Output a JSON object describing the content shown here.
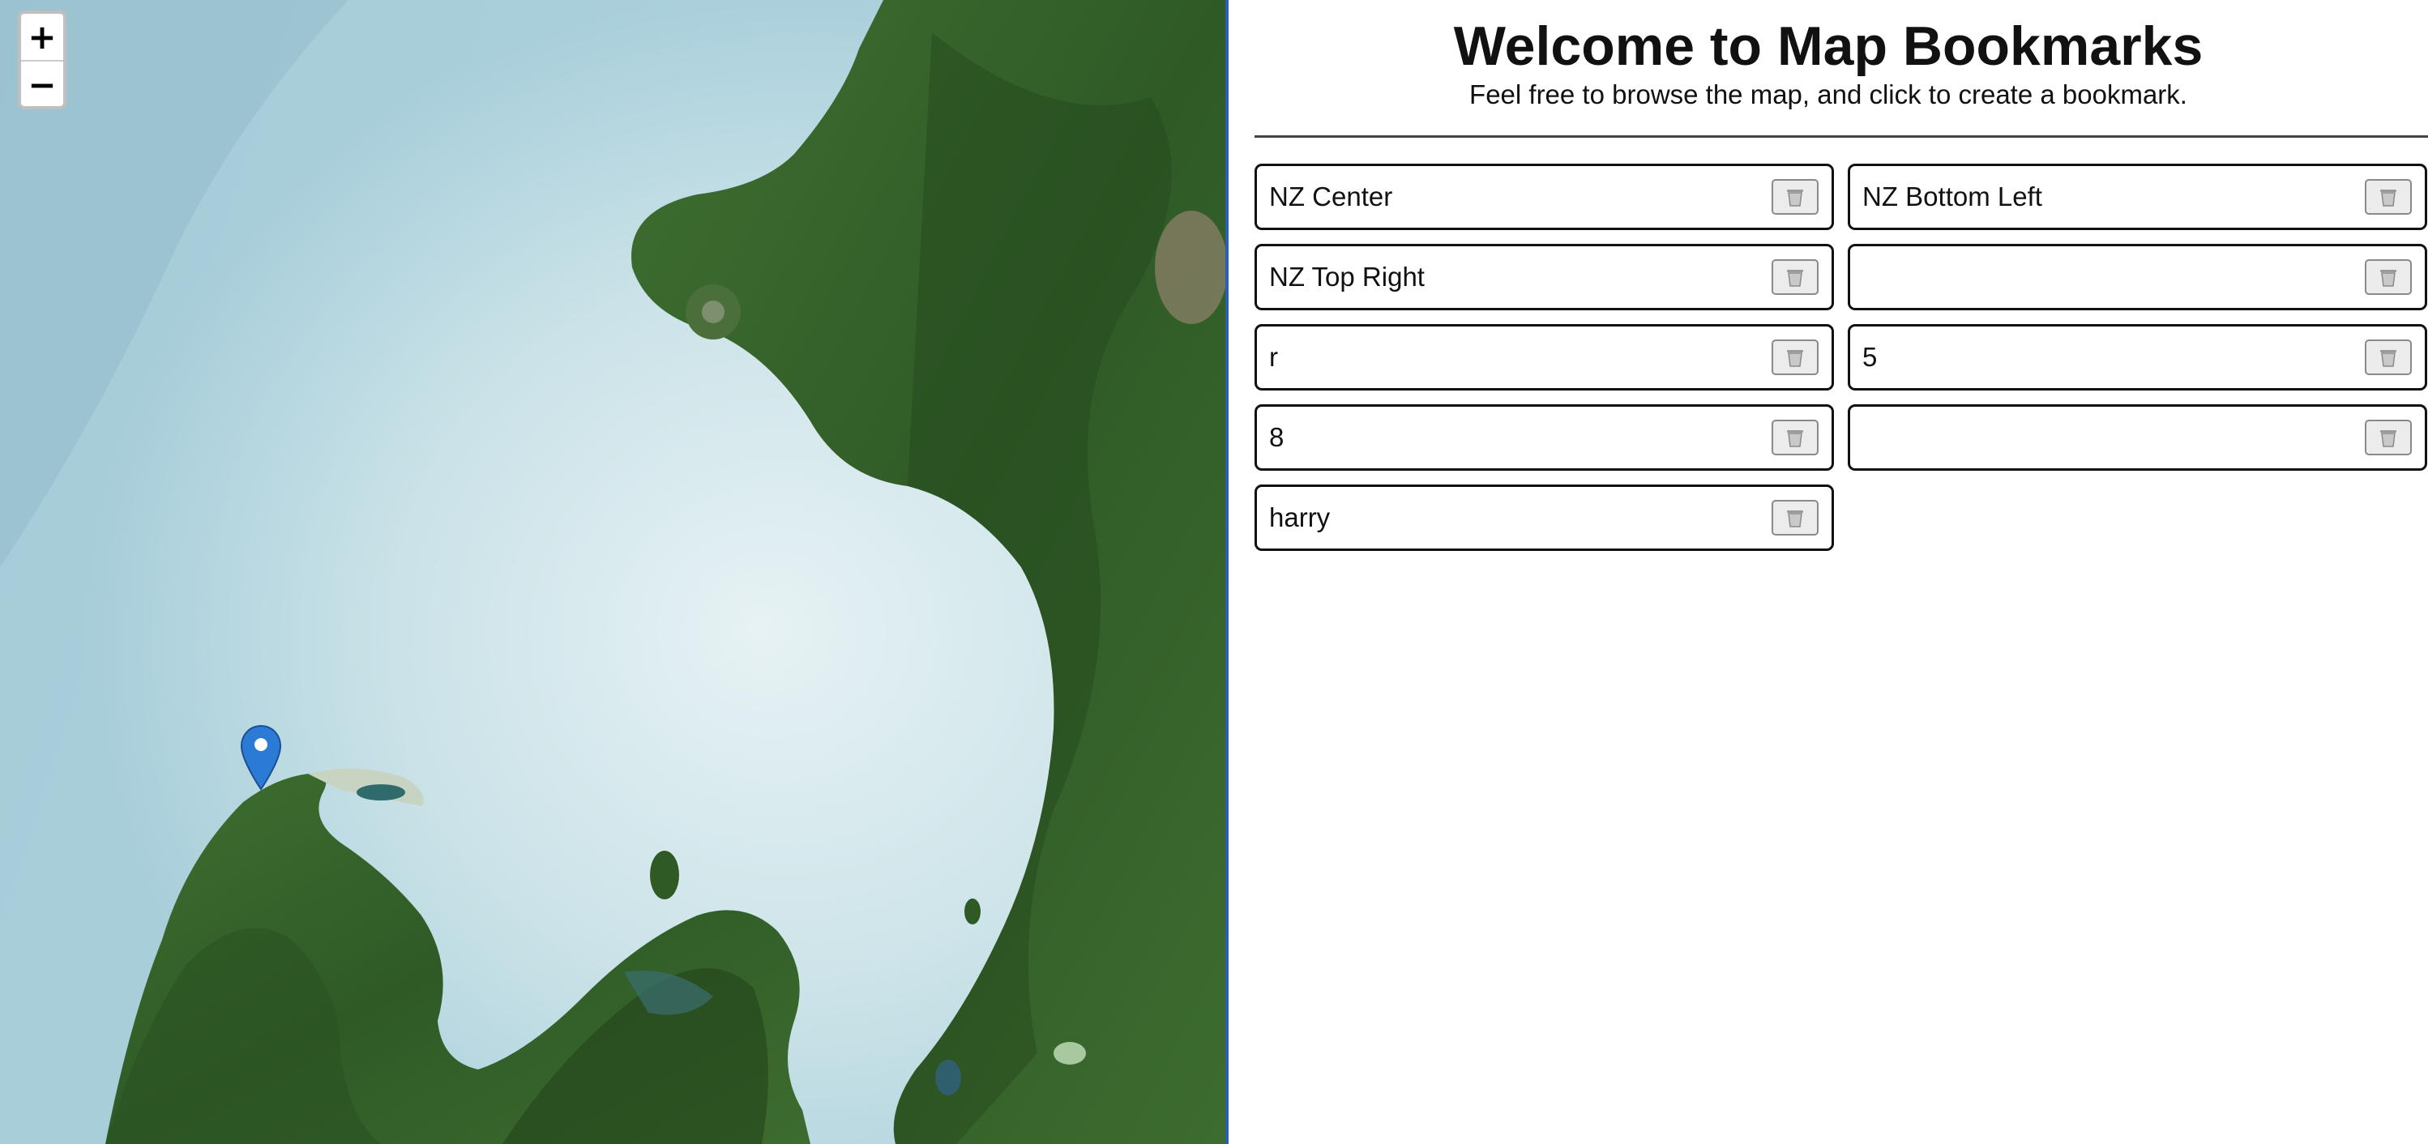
{
  "map": {
    "zoom_in_label": "+",
    "zoom_out_label": "−",
    "marker_icon": "map-pin-icon",
    "colors": {
      "ocean_deep": "#9cc3d2",
      "ocean_shallow": "#dcecf0",
      "land": "#3d6a2e",
      "land_dark": "#24461d",
      "marker": "#2b7bd6",
      "divider": "#2b5fb3"
    }
  },
  "header": {
    "title": "Welcome to Map Bookmarks",
    "subtitle": "Feel free to browse the map, and click to create a bookmark."
  },
  "bookmarks": {
    "delete_icon": "trash-icon",
    "items": [
      {
        "name": "NZ Center"
      },
      {
        "name": "NZ Bottom Left"
      },
      {
        "name": "NZ Top Right"
      },
      {
        "name": ""
      },
      {
        "name": "r"
      },
      {
        "name": "5"
      },
      {
        "name": "8"
      },
      {
        "name": ""
      },
      {
        "name": "harry"
      }
    ]
  }
}
